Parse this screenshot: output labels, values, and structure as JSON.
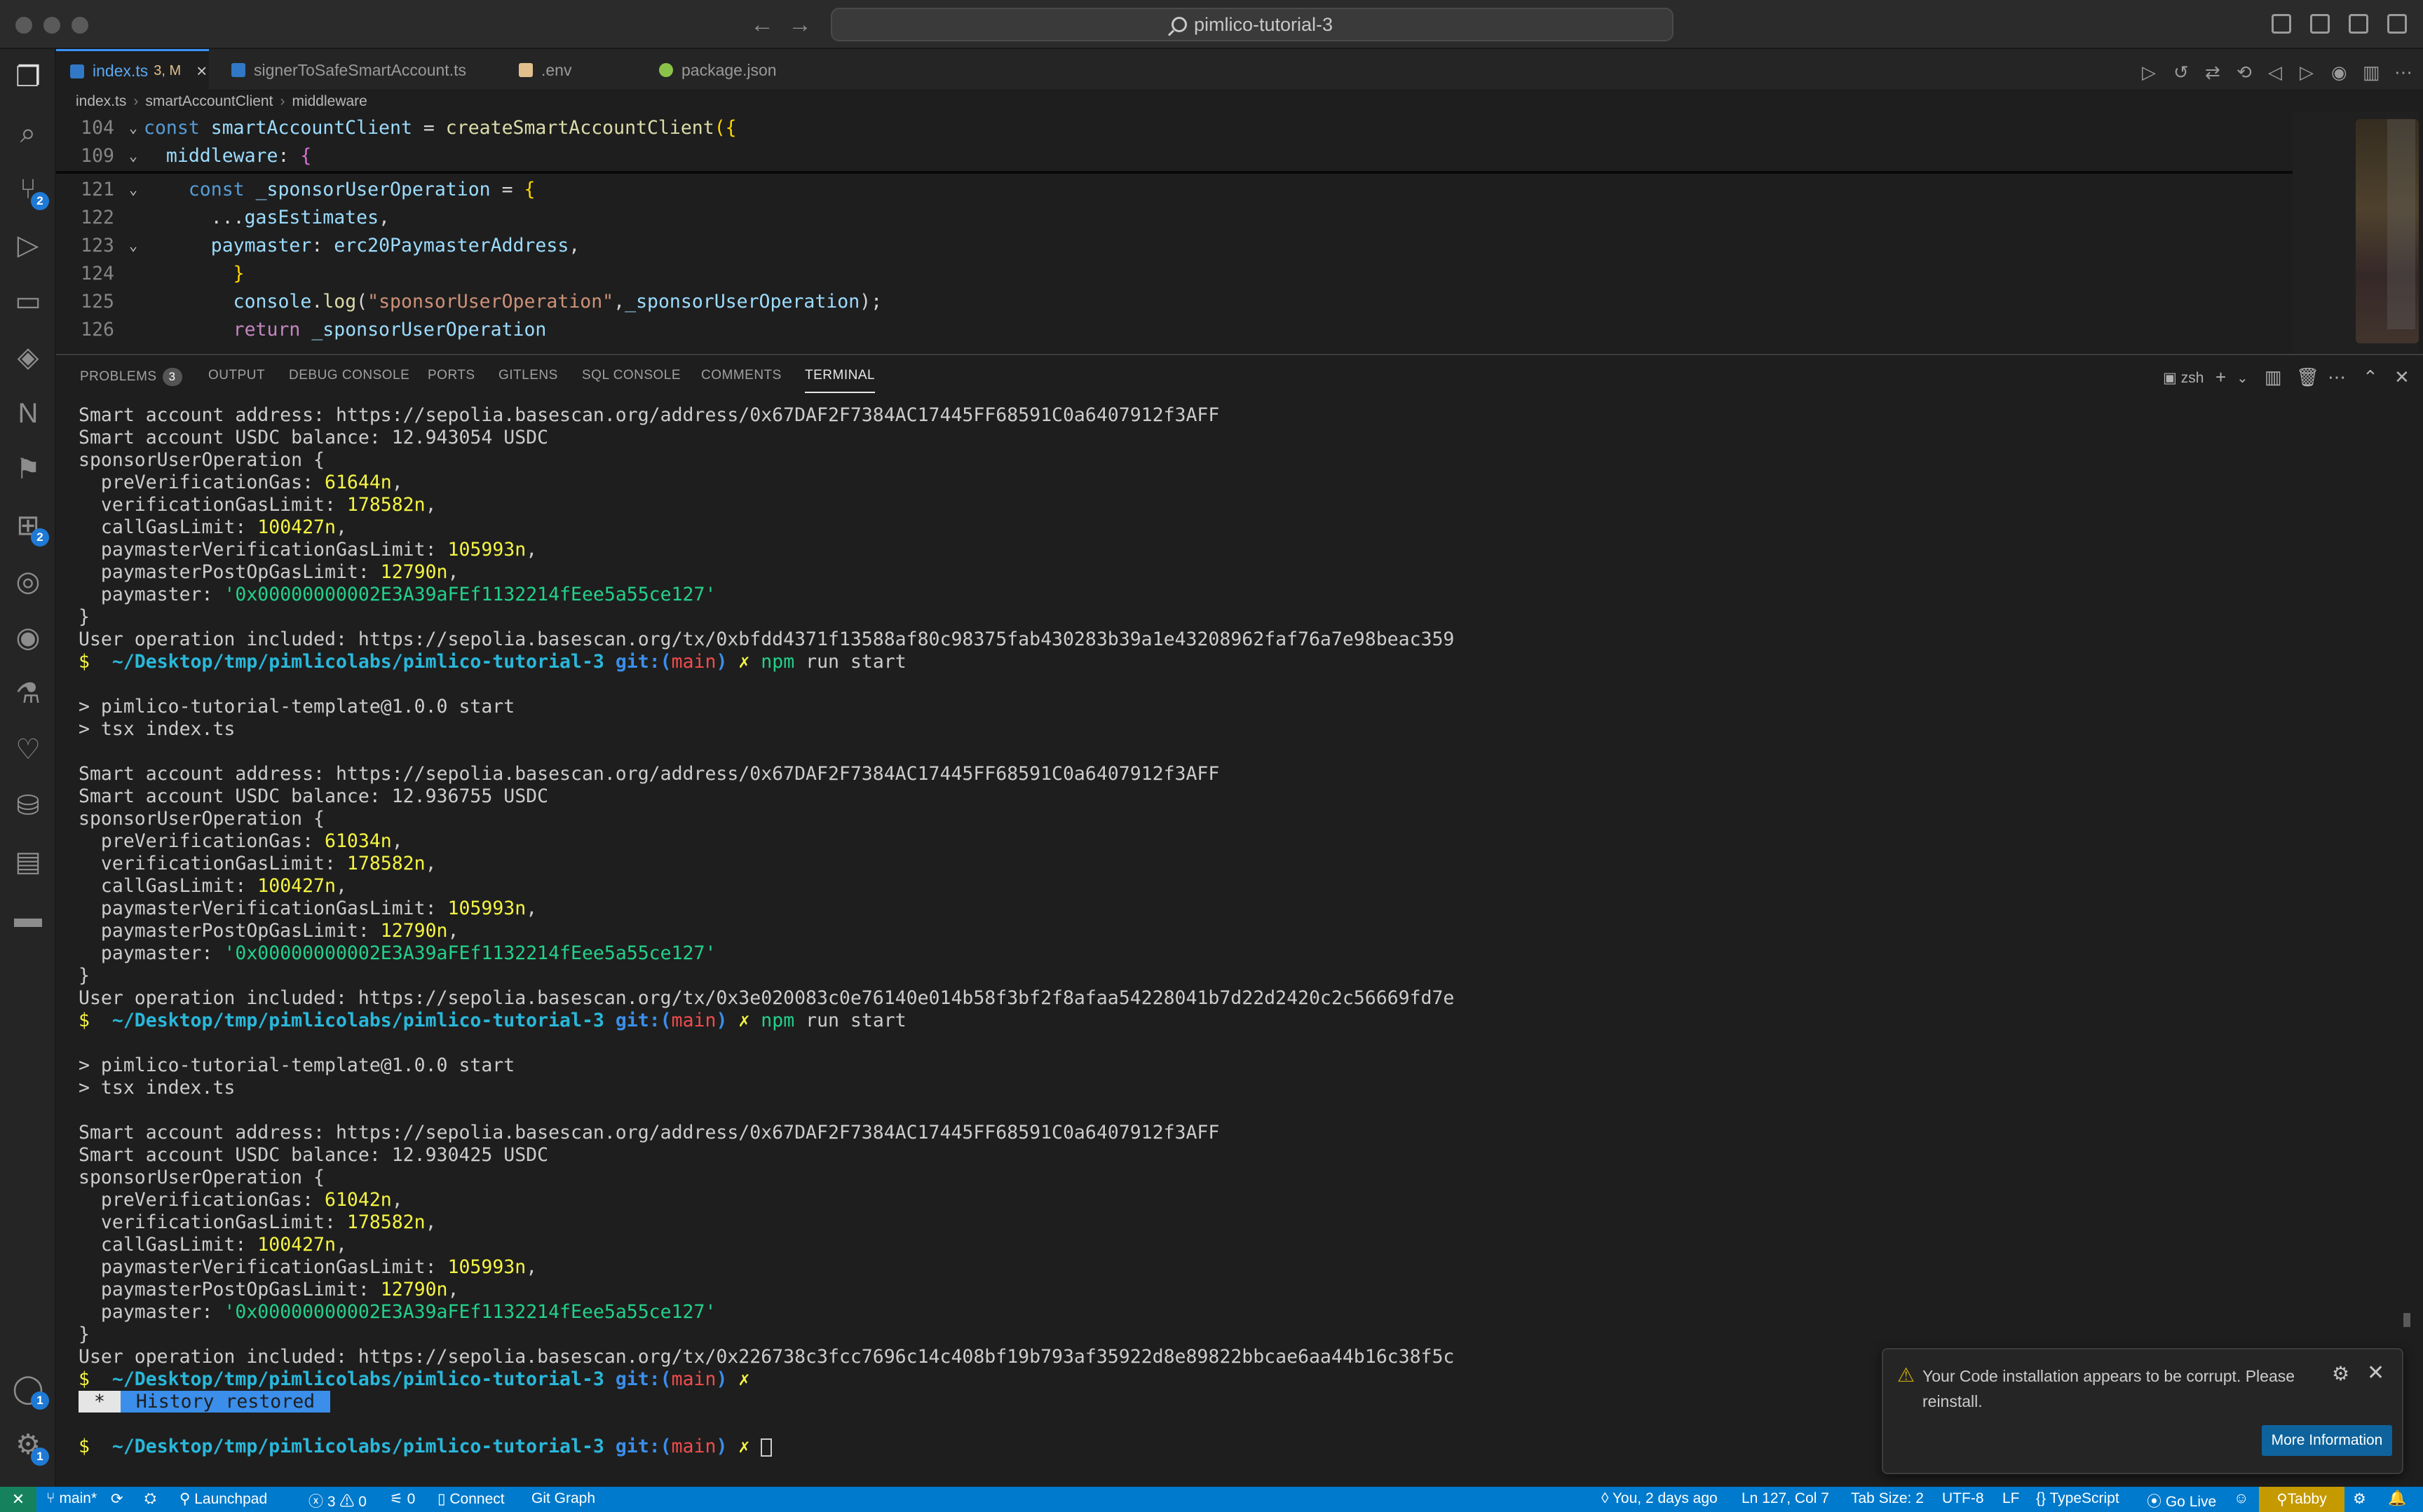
{
  "window": {
    "search_text": "pimlico-tutorial-3"
  },
  "tabs": [
    {
      "label": "index.ts",
      "modified": "3, M",
      "close": "×"
    },
    {
      "label": "signerToSafeSmartAccount.ts"
    },
    {
      "label": ".env"
    },
    {
      "label": "package.json"
    }
  ],
  "breadcrumb": {
    "file": "index.ts",
    "symbol": "smartAccountClient",
    "member": "middleware",
    "sep": "›"
  },
  "editor": {
    "lines": [
      {
        "num": "104",
        "fold": "⌄",
        "parts": [
          [
            "kw",
            "const "
          ],
          [
            "var",
            "smartAccountClient"
          ],
          [
            "code",
            " = "
          ],
          [
            "fn",
            "createSmartAccountClient"
          ],
          [
            "brace",
            "({"
          ]
        ]
      },
      {
        "num": "109",
        "fold": "⌄",
        "parts": [
          [
            "code",
            "  "
          ],
          [
            "var",
            "middleware"
          ],
          [
            "code",
            ": "
          ],
          [
            "brace2",
            "{"
          ]
        ]
      },
      {
        "num": "121",
        "fold": "⌄",
        "parts": [
          [
            "code",
            "    "
          ],
          [
            "kw",
            "const "
          ],
          [
            "var",
            "_sponsorUserOperation"
          ],
          [
            "code",
            " = "
          ],
          [
            "brace",
            "{"
          ]
        ]
      },
      {
        "num": "122",
        "fold": "",
        "parts": [
          [
            "code",
            "      ..."
          ],
          [
            "var",
            "gasEstimates"
          ],
          [
            "code",
            ","
          ]
        ]
      },
      {
        "num": "123",
        "fold": "⌄",
        "parts": [
          [
            "code",
            "      "
          ],
          [
            "var",
            "paymaster"
          ],
          [
            "code",
            ": "
          ],
          [
            "var",
            "erc20PaymasterAddress"
          ],
          [
            "code",
            ","
          ]
        ]
      },
      {
        "num": "124",
        "fold": "",
        "parts": [
          [
            "code",
            "        "
          ],
          [
            "brace",
            "}"
          ]
        ]
      },
      {
        "num": "125",
        "fold": "",
        "parts": [
          [
            "code",
            "        "
          ],
          [
            "var",
            "console"
          ],
          [
            "code",
            "."
          ],
          [
            "fn",
            "log"
          ],
          [
            "code",
            "("
          ],
          [
            "str",
            "\"sponsorUserOperation\""
          ],
          [
            "code",
            ","
          ],
          [
            "var",
            "_sponsorUserOperation"
          ],
          [
            "code",
            ");"
          ]
        ]
      },
      {
        "num": "126",
        "fold": "",
        "parts": [
          [
            "code",
            "        "
          ],
          [
            "kw2",
            "return "
          ],
          [
            "var",
            "_sponsorUserOperation"
          ]
        ]
      }
    ]
  },
  "panel": {
    "tabs": [
      "PROBLEMS",
      "OUTPUT",
      "DEBUG CONSOLE",
      "PORTS",
      "GITLENS",
      "SQL CONSOLE",
      "COMMENTS",
      "TERMINAL"
    ],
    "problems_count": "3",
    "shell": "zsh"
  },
  "terminal": {
    "lines": [
      [
        [
          "",
          "Smart account address: https://sepolia.basescan.org/address/0x67DAF2F7384AC17445FF68591C0a6407912f3AFF"
        ]
      ],
      [
        [
          "",
          "Smart account USDC balance: 12.943054 USDC"
        ]
      ],
      [
        [
          "",
          "sponsorUserOperation {"
        ]
      ],
      [
        [
          "",
          "  preVerificationGas: "
        ],
        [
          "t-yellow",
          "61644n"
        ],
        [
          "",
          ","
        ]
      ],
      [
        [
          "",
          "  verificationGasLimit: "
        ],
        [
          "t-yellow",
          "178582n"
        ],
        [
          "",
          ","
        ]
      ],
      [
        [
          "",
          "  callGasLimit: "
        ],
        [
          "t-yellow",
          "100427n"
        ],
        [
          "",
          ","
        ]
      ],
      [
        [
          "",
          "  paymasterVerificationGasLimit: "
        ],
        [
          "t-yellow",
          "105993n"
        ],
        [
          "",
          ","
        ]
      ],
      [
        [
          "",
          "  paymasterPostOpGasLimit: "
        ],
        [
          "t-yellow",
          "12790n"
        ],
        [
          "",
          ","
        ]
      ],
      [
        [
          "",
          "  paymaster: "
        ],
        [
          "t-green",
          "'0x00000000002E3A39aFEf1132214fEee5a55ce127'"
        ]
      ],
      [
        [
          "",
          "}"
        ]
      ],
      [
        [
          "",
          "User operation included: https://sepolia.basescan.org/tx/0xbfdd4371f13588af80c98375fab430283b39a1e43208962faf76a7e98beac359"
        ]
      ],
      [
        [
          "t-prompt",
          "$ "
        ],
        [
          "t-cyan",
          " ~/Desktop/tmp/pimlicolabs/pimlico-tutorial-3 "
        ],
        [
          "t-blue",
          "git:("
        ],
        [
          "t-red",
          "main"
        ],
        [
          "t-blue",
          ")"
        ],
        [
          "t-prompt",
          " ✗ "
        ],
        [
          "t-green",
          "npm "
        ],
        [
          "",
          "run start"
        ]
      ],
      [
        [
          "",
          ""
        ]
      ],
      [
        [
          "",
          "> pimlico-tutorial-template@1.0.0 start"
        ]
      ],
      [
        [
          "",
          "> tsx index.ts"
        ]
      ],
      [
        [
          "",
          ""
        ]
      ],
      [
        [
          "",
          "Smart account address: https://sepolia.basescan.org/address/0x67DAF2F7384AC17445FF68591C0a6407912f3AFF"
        ]
      ],
      [
        [
          "",
          "Smart account USDC balance: 12.936755 USDC"
        ]
      ],
      [
        [
          "",
          "sponsorUserOperation {"
        ]
      ],
      [
        [
          "",
          "  preVerificationGas: "
        ],
        [
          "t-yellow",
          "61034n"
        ],
        [
          "",
          ","
        ]
      ],
      [
        [
          "",
          "  verificationGasLimit: "
        ],
        [
          "t-yellow",
          "178582n"
        ],
        [
          "",
          ","
        ]
      ],
      [
        [
          "",
          "  callGasLimit: "
        ],
        [
          "t-yellow",
          "100427n"
        ],
        [
          "",
          ","
        ]
      ],
      [
        [
          "",
          "  paymasterVerificationGasLimit: "
        ],
        [
          "t-yellow",
          "105993n"
        ],
        [
          "",
          ","
        ]
      ],
      [
        [
          "",
          "  paymasterPostOpGasLimit: "
        ],
        [
          "t-yellow",
          "12790n"
        ],
        [
          "",
          ","
        ]
      ],
      [
        [
          "",
          "  paymaster: "
        ],
        [
          "t-green",
          "'0x00000000002E3A39aFEf1132214fEee5a55ce127'"
        ]
      ],
      [
        [
          "",
          "}"
        ]
      ],
      [
        [
          "",
          "User operation included: https://sepolia.basescan.org/tx/0x3e020083c0e76140e014b58f3bf2f8afaa54228041b7d22d2420c2c56669fd7e"
        ]
      ],
      [
        [
          "t-prompt",
          "$ "
        ],
        [
          "t-cyan",
          " ~/Desktop/tmp/pimlicolabs/pimlico-tutorial-3 "
        ],
        [
          "t-blue",
          "git:("
        ],
        [
          "t-red",
          "main"
        ],
        [
          "t-blue",
          ")"
        ],
        [
          "t-prompt",
          " ✗ "
        ],
        [
          "t-green",
          "npm "
        ],
        [
          "",
          "run start"
        ]
      ],
      [
        [
          "",
          ""
        ]
      ],
      [
        [
          "",
          "> pimlico-tutorial-template@1.0.0 start"
        ]
      ],
      [
        [
          "",
          "> tsx index.ts"
        ]
      ],
      [
        [
          "",
          ""
        ]
      ],
      [
        [
          "",
          "Smart account address: https://sepolia.basescan.org/address/0x67DAF2F7384AC17445FF68591C0a6407912f3AFF"
        ]
      ],
      [
        [
          "",
          "Smart account USDC balance: 12.930425 USDC"
        ]
      ],
      [
        [
          "",
          "sponsorUserOperation {"
        ]
      ],
      [
        [
          "",
          "  preVerificationGas: "
        ],
        [
          "t-yellow",
          "61042n"
        ],
        [
          "",
          ","
        ]
      ],
      [
        [
          "",
          "  verificationGasLimit: "
        ],
        [
          "t-yellow",
          "178582n"
        ],
        [
          "",
          ","
        ]
      ],
      [
        [
          "",
          "  callGasLimit: "
        ],
        [
          "t-yellow",
          "100427n"
        ],
        [
          "",
          ","
        ]
      ],
      [
        [
          "",
          "  paymasterVerificationGasLimit: "
        ],
        [
          "t-yellow",
          "105993n"
        ],
        [
          "",
          ","
        ]
      ],
      [
        [
          "",
          "  paymasterPostOpGasLimit: "
        ],
        [
          "t-yellow",
          "12790n"
        ],
        [
          "",
          ","
        ]
      ],
      [
        [
          "",
          "  paymaster: "
        ],
        [
          "t-green",
          "'0x00000000002E3A39aFEf1132214fEee5a55ce127'"
        ]
      ],
      [
        [
          "",
          "}"
        ]
      ],
      [
        [
          "",
          "User operation included: https://sepolia.basescan.org/tx/0x226738c3fcc7696c14c408bf19b793af35922d8e89822bbcae6aa44b16c38f5c"
        ]
      ],
      [
        [
          "t-prompt",
          "$ "
        ],
        [
          "t-cyan",
          " ~/Desktop/tmp/pimlicolabs/pimlico-tutorial-3 "
        ],
        [
          "t-blue",
          "git:("
        ],
        [
          "t-red",
          "main"
        ],
        [
          "t-blue",
          ")"
        ],
        [
          "t-prompt",
          " ✗"
        ]
      ],
      [
        [
          "history-star",
          " * "
        ],
        [
          "history-box",
          " History restored "
        ]
      ],
      [
        [
          "",
          ""
        ]
      ],
      [
        [
          "t-prompt",
          "$ "
        ],
        [
          "t-cyan",
          " ~/Desktop/tmp/pimlicolabs/pimlico-tutorial-3 "
        ],
        [
          "t-blue",
          "git:("
        ],
        [
          "t-red",
          "main"
        ],
        [
          "t-blue",
          ")"
        ],
        [
          "t-prompt",
          " ✗ "
        ],
        [
          "cursor",
          ""
        ]
      ]
    ]
  },
  "notification": {
    "message": "Your Code installation appears to be corrupt. Please reinstall.",
    "button": "More Information"
  },
  "statusbar": {
    "branch": "main*",
    "launchpad": "Launchpad",
    "errors": "3",
    "warnings": "0",
    "ports": "0",
    "connect": "Connect",
    "git_graph": "Git Graph",
    "blame": "You, 2 days ago",
    "position": "Ln 127, Col 7",
    "tab_size": "Tab Size: 2",
    "encoding": "UTF-8",
    "eol": "LF",
    "language": "TypeScript",
    "go_live": "Go Live",
    "tabby": "Tabby"
  },
  "colors": {
    "accent": "#007acc",
    "tab_active": "#3794ff",
    "warning": "#cca700"
  }
}
